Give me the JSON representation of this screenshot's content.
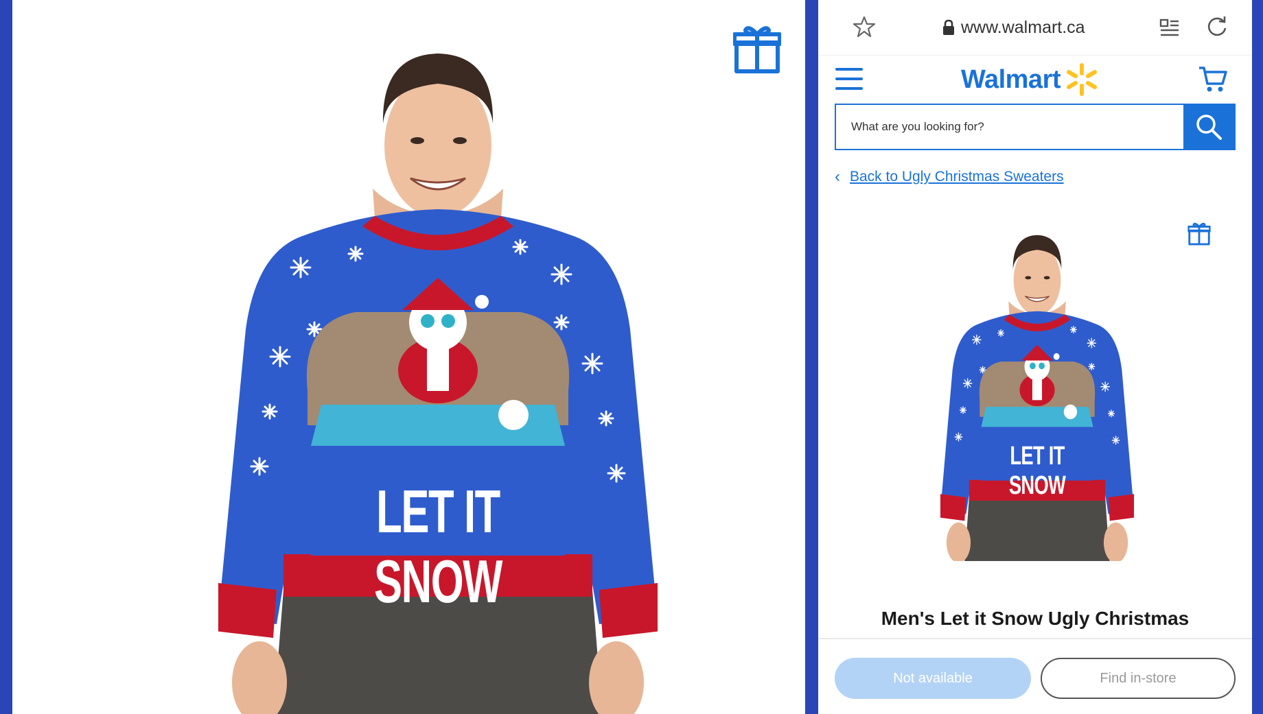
{
  "browser": {
    "url": "www.walmart.ca"
  },
  "header": {
    "logo_text": "Walmart"
  },
  "search": {
    "placeholder": "What are you looking for?"
  },
  "breadcrumb": {
    "back_label": "Back to Ugly Christmas Sweaters"
  },
  "product": {
    "title": "Men's Let it Snow Ugly Christmas",
    "sweater_text": "LET IT SNOW"
  },
  "actions": {
    "not_available_label": "Not available",
    "find_in_store_label": "Find in-store"
  },
  "colors": {
    "brand_blue": "#1a72d8",
    "spark_yellow": "#ffc220",
    "sweater_blue": "#2f5ccc",
    "sweater_red": "#c8172b",
    "disabled_button": "#b2d3f5",
    "frame_blue": "#2a45b8"
  },
  "icons": [
    "gift-icon",
    "star-icon",
    "lock-icon",
    "reader-icon",
    "reload-icon",
    "menu-icon",
    "spark-icon",
    "cart-icon",
    "search-icon",
    "chevron-left-icon"
  ]
}
